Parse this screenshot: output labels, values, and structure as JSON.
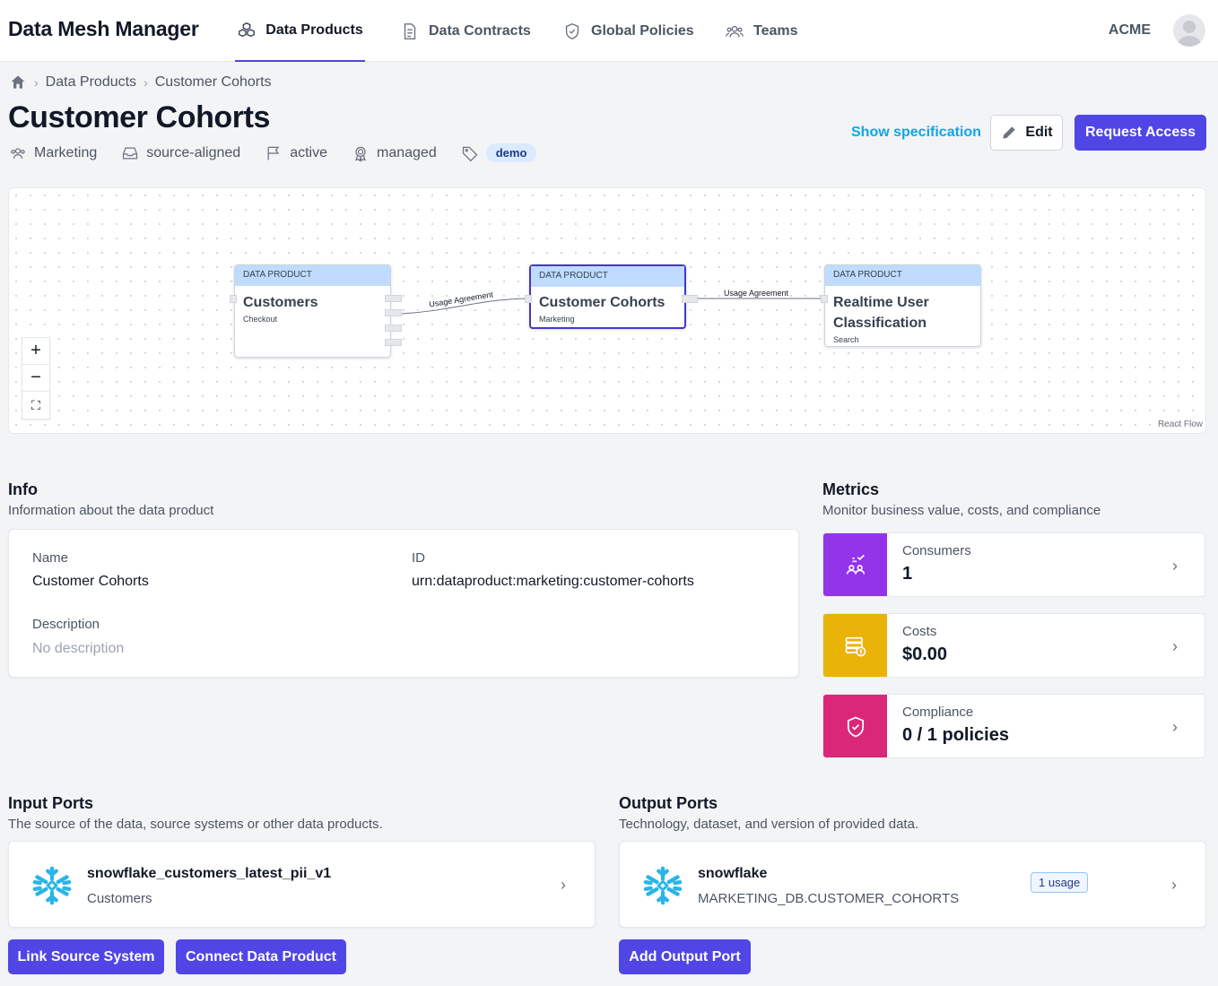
{
  "app": {
    "title": "Data Mesh Manager",
    "org": "ACME"
  },
  "nav": {
    "tabs": [
      {
        "label": "Data Products",
        "icon": "cubes-icon",
        "active": true
      },
      {
        "label": "Data Contracts",
        "icon": "document-icon",
        "active": false
      },
      {
        "label": "Global Policies",
        "icon": "shield-icon",
        "active": false
      },
      {
        "label": "Teams",
        "icon": "users-icon",
        "active": false
      }
    ]
  },
  "breadcrumb": {
    "items": [
      "Data Products",
      "Customer Cohorts"
    ]
  },
  "page": {
    "title": "Customer Cohorts",
    "tags": {
      "team": "Marketing",
      "type": "source-aligned",
      "status": "active",
      "mode": "managed",
      "label": "demo"
    },
    "actions": {
      "show_spec": "Show specification",
      "edit": "Edit",
      "request_access": "Request Access"
    }
  },
  "flow": {
    "nodes": [
      {
        "type": "DATA PRODUCT",
        "title": "Customers",
        "team": "Checkout"
      },
      {
        "type": "DATA PRODUCT",
        "title": "Customer Cohorts",
        "team": "Marketing"
      },
      {
        "type": "DATA PRODUCT",
        "title": "Realtime User Classification",
        "team": "Search"
      }
    ],
    "edges": [
      {
        "label": "Usage Agreement"
      },
      {
        "label": "Usage Agreement"
      }
    ],
    "controls": {
      "zoom_in": "+",
      "zoom_out": "−",
      "fit": "⛶"
    },
    "credit": "React Flow"
  },
  "info": {
    "title": "Info",
    "subtitle": "Information about the data product",
    "name_label": "Name",
    "name_value": "Customer Cohorts",
    "id_label": "ID",
    "id_value": "urn:dataproduct:marketing:customer-cohorts",
    "desc_label": "Description",
    "desc_value": "No description"
  },
  "metrics": {
    "title": "Metrics",
    "subtitle": "Monitor business value, costs, and compliance",
    "items": [
      {
        "label": "Consumers",
        "value": "1",
        "color": "#9333ea",
        "icon": "consumers-icon"
      },
      {
        "label": "Costs",
        "value": "$0.00",
        "color": "#eab308",
        "icon": "costs-icon"
      },
      {
        "label": "Compliance",
        "value": "0 / 1 policies",
        "color": "#db2777",
        "icon": "compliance-shield-icon"
      }
    ]
  },
  "input_ports": {
    "title": "Input Ports",
    "subtitle": "The source of the data, source systems or other data products.",
    "items": [
      {
        "name": "snowflake_customers_latest_pii_v1",
        "sub": "Customers",
        "icon": "snowflake-icon"
      }
    ],
    "buttons": {
      "link_source": "Link Source System",
      "connect_product": "Connect Data Product"
    }
  },
  "output_ports": {
    "title": "Output Ports",
    "subtitle": "Technology, dataset, and version of provided data.",
    "items": [
      {
        "name": "snowflake",
        "sub": "MARKETING_DB.CUSTOMER_COHORTS",
        "usage": "1 usage",
        "icon": "snowflake-icon"
      }
    ],
    "buttons": {
      "add_output": "Add Output Port"
    }
  },
  "colors": {
    "accent": "#4f46e5",
    "link": "#0ea5e9",
    "node_header": "#bfdbfe"
  }
}
